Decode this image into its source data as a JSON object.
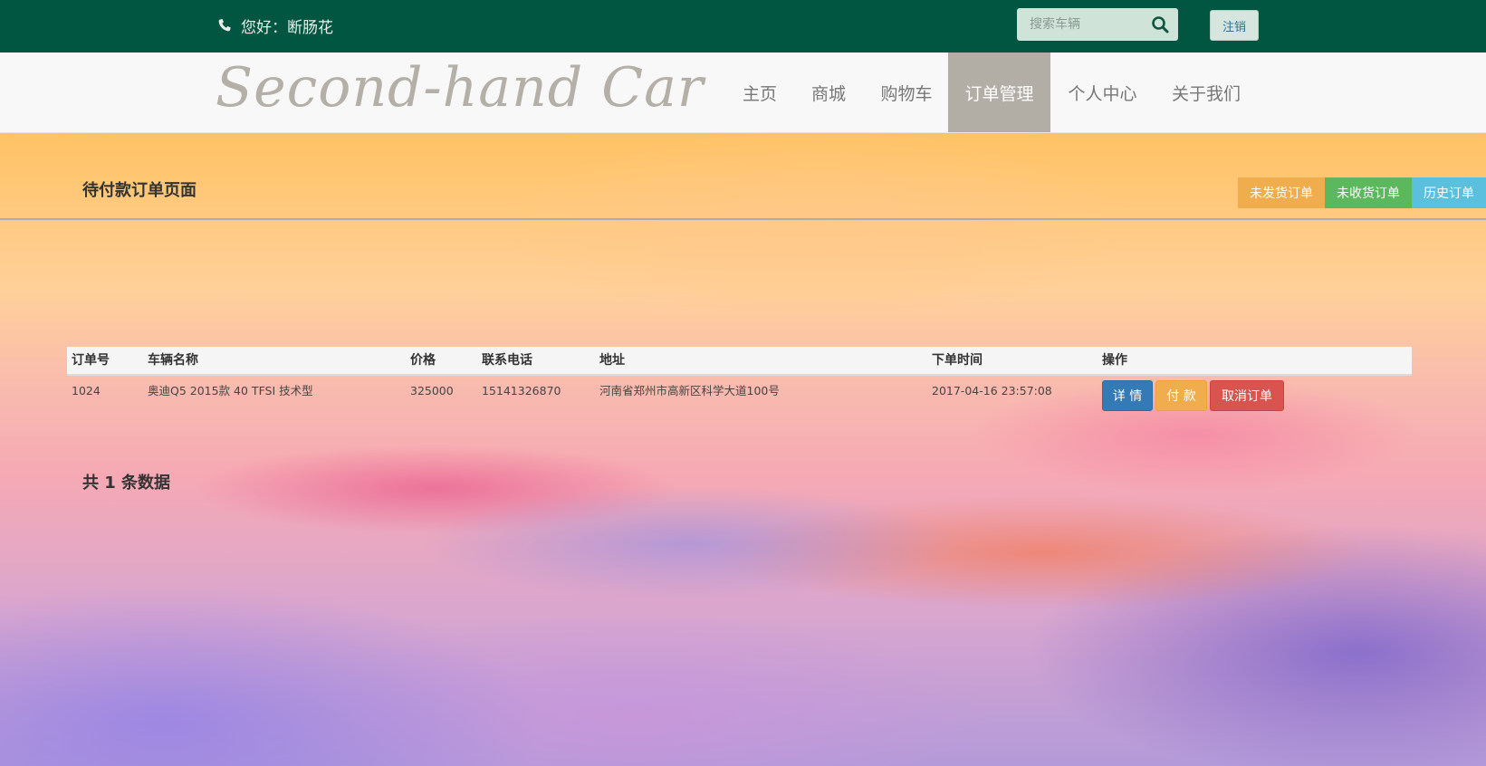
{
  "topbar": {
    "greeting": "您好：断肠花",
    "search_placeholder": "搜索车辆",
    "logout_label": "注销"
  },
  "navbar": {
    "logo_text": "Second-hand Car",
    "items": [
      {
        "label": "主页"
      },
      {
        "label": "商城"
      },
      {
        "label": "购物车"
      },
      {
        "label": "订单管理",
        "active": true
      },
      {
        "label": "个人中心"
      },
      {
        "label": "关于我们"
      }
    ]
  },
  "section": {
    "title": "待付款订单页面",
    "filters": [
      {
        "label": "未发货订单",
        "color": "#f0ad4e"
      },
      {
        "label": "未收货订单",
        "color": "#5cb85c"
      },
      {
        "label": "历史订单",
        "color": "#5bc0de"
      }
    ]
  },
  "table": {
    "columns": [
      "订单号",
      "车辆名称",
      "价格",
      "联系电话",
      "地址",
      "下单时间",
      "操作"
    ],
    "rows": [
      {
        "order_id": "1024",
        "car_name": "奥迪Q5 2015款 40 TFSI 技术型",
        "price": "325000",
        "phone": "15141326870",
        "address": "河南省郑州市高新区科学大道100号",
        "order_time": "2017-04-16 23:57:08",
        "actions": [
          {
            "label": "详 情",
            "color": "#337ab7"
          },
          {
            "label": "付 款",
            "color": "#f0ad4e"
          },
          {
            "label": "取消订单",
            "color": "#d9534f"
          }
        ]
      }
    ]
  },
  "footer": {
    "total_text": "共 1 条数据"
  },
  "colors": {
    "topbar_bg": "#015641",
    "nav_active_bg": "#b2ada5"
  }
}
